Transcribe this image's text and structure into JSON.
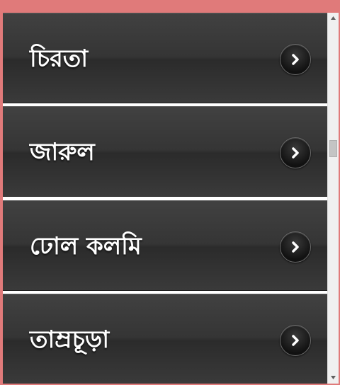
{
  "list": {
    "items": [
      {
        "label": "চিরতা"
      },
      {
        "label": "জারুল"
      },
      {
        "label": "ঢোল কলমি"
      },
      {
        "label": "তাম্রচূড়া"
      }
    ],
    "arrow_icon": "chevron-right-icon"
  },
  "colors": {
    "page_background": "#e07a7a",
    "item_background": "#373737",
    "item_text": "#ffffff",
    "arrow_background": "#1a1a1a"
  }
}
